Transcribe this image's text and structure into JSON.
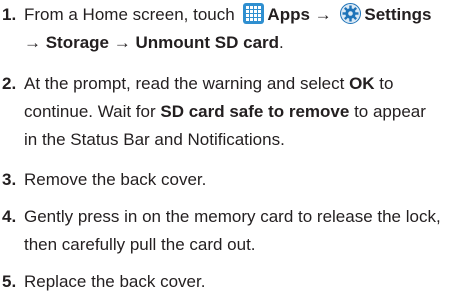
{
  "steps": [
    {
      "number": "1.",
      "line1": {
        "pre": "From a Home screen, touch ",
        "apps": "Apps → ",
        "settings": "Settings"
      },
      "line2": {
        "path": "→ Storage → Unmount SD card",
        "end": "."
      },
      "icons": [
        "apps-grid-icon",
        "settings-gear-icon"
      ]
    },
    {
      "number": "2.",
      "line1": {
        "pre": "At the prompt, read the warning and select ",
        "ok": "OK",
        "post": " to"
      },
      "line2": {
        "pre": "continue. Wait for ",
        "bold": "SD card safe to remove",
        "post": " to appear"
      },
      "line3": "in the Status Bar and Notifications."
    },
    {
      "number": "3.",
      "line1": "Remove the back cover."
    },
    {
      "number": "4.",
      "line1": "Gently press in on the memory card to release the lock,",
      "line2": "then carefully pull the card out."
    },
    {
      "number": "5.",
      "line1": "Replace the back cover."
    }
  ],
  "colors": {
    "text": "#231f20",
    "apps_icon_blue": "#2f8fd0",
    "settings_icon_blue": "#1e73b8"
  }
}
